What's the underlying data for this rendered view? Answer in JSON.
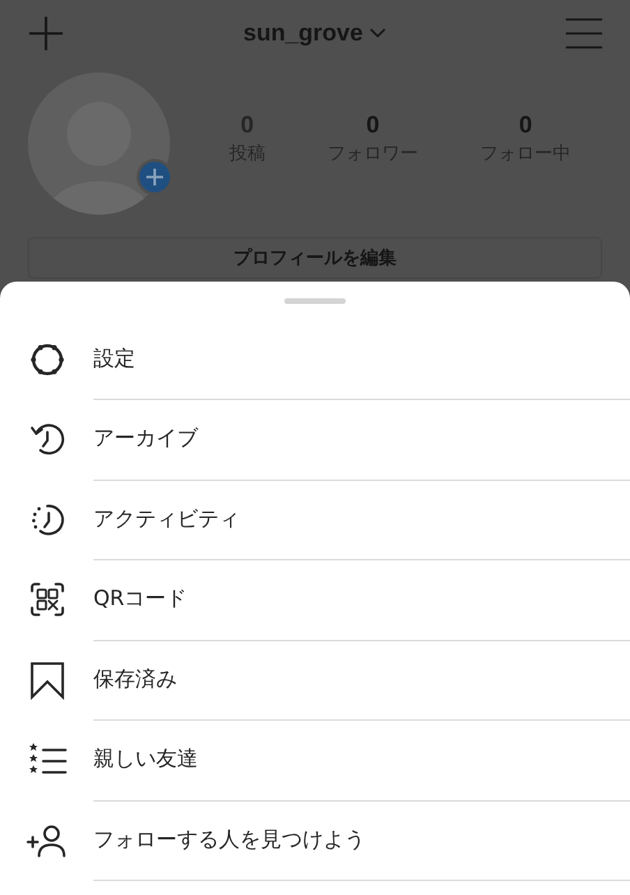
{
  "header": {
    "username": "sun_grove"
  },
  "profile": {
    "stats": [
      {
        "count": "0",
        "label": "投稿"
      },
      {
        "count": "0",
        "label": "フォロワー"
      },
      {
        "count": "0",
        "label": "フォロー中"
      }
    ],
    "edit_button": "プロフィールを編集"
  },
  "menu": [
    {
      "kind": "settings",
      "label": "設定"
    },
    {
      "kind": "archive",
      "label": "アーカイブ"
    },
    {
      "kind": "activity",
      "label": "アクティビティ"
    },
    {
      "kind": "qr",
      "label": "QRコード"
    },
    {
      "kind": "saved",
      "label": "保存済み"
    },
    {
      "kind": "friends",
      "label": "親しい友達"
    },
    {
      "kind": "discover",
      "label": "フォローする人を見つけよう"
    }
  ]
}
